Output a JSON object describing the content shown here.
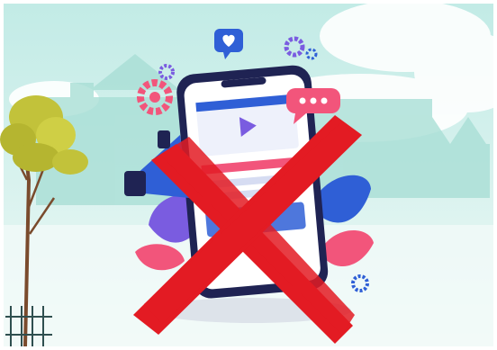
{
  "illustration": {
    "subject": "smartphone-social-media",
    "overlay": "red-x-cross"
  },
  "colors": {
    "sky_top": "#bfe9e4",
    "sky_bottom": "#e9f7f4",
    "cloud": "#ffffff",
    "building": "#a9dfd6",
    "phone_body": "#1f2353",
    "phone_screen": "#ffffff",
    "accent_blue": "#2f5fd6",
    "accent_purple": "#7a5ce0",
    "accent_pink": "#f2557b",
    "cross_red": "#e31b23",
    "tree_leaf": "#c2c23a",
    "tree_trunk": "#7a4b2d",
    "fence": "#2f4f4f"
  },
  "icons": [
    "heart-bubble-icon",
    "gear-icon",
    "chat-bubble-icon",
    "play-icon",
    "megaphone-icon"
  ]
}
